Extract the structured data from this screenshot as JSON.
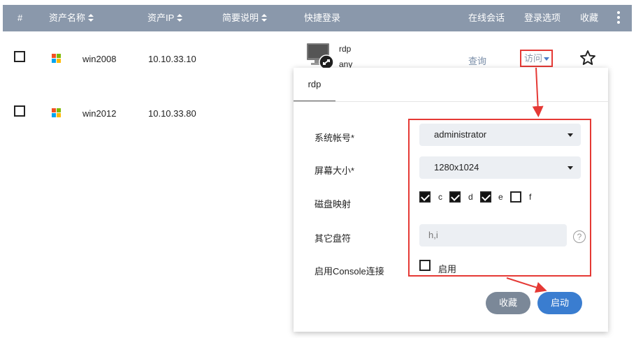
{
  "header": {
    "hash": "#",
    "asset_name": "资产名称",
    "asset_ip": "资产IP",
    "description": "简要说明",
    "quick_login": "快捷登录",
    "online_session": "在线会话",
    "login_options": "登录选项",
    "favorite": "收藏"
  },
  "rows": [
    {
      "name": "win2008",
      "ip": "10.10.33.10",
      "protocol": "rdp",
      "account": "any",
      "query": "查询",
      "visit": "访问"
    },
    {
      "name": "win2012",
      "ip": "10.10.33.80"
    }
  ],
  "popup": {
    "tab": "rdp",
    "system_account_label": "系统帐号*",
    "system_account_value": "administrator",
    "screen_size_label": "屏幕大小*",
    "screen_size_value": "1280x1024",
    "disk_mapping_label": "磁盘映射",
    "disks": [
      {
        "label": "c",
        "checked": true
      },
      {
        "label": "d",
        "checked": true
      },
      {
        "label": "e",
        "checked": true
      },
      {
        "label": "f",
        "checked": false
      }
    ],
    "other_drives_label": "其它盘符",
    "other_drives_value": "h,i",
    "help": "?",
    "console_label": "启用Console连接",
    "console_checkbox_label": "启用",
    "favorite_button": "收藏",
    "start_button": "启动"
  },
  "colors": {
    "header_bg": "#8a98ab",
    "highlight": "#e53935",
    "primary": "#3a7dd0",
    "secondary": "#7b8898"
  },
  "icons": [
    "windows-icon",
    "rdp-monitor-icon",
    "star-icon",
    "kebab-icon",
    "help-icon",
    "caret-down-icon"
  ]
}
